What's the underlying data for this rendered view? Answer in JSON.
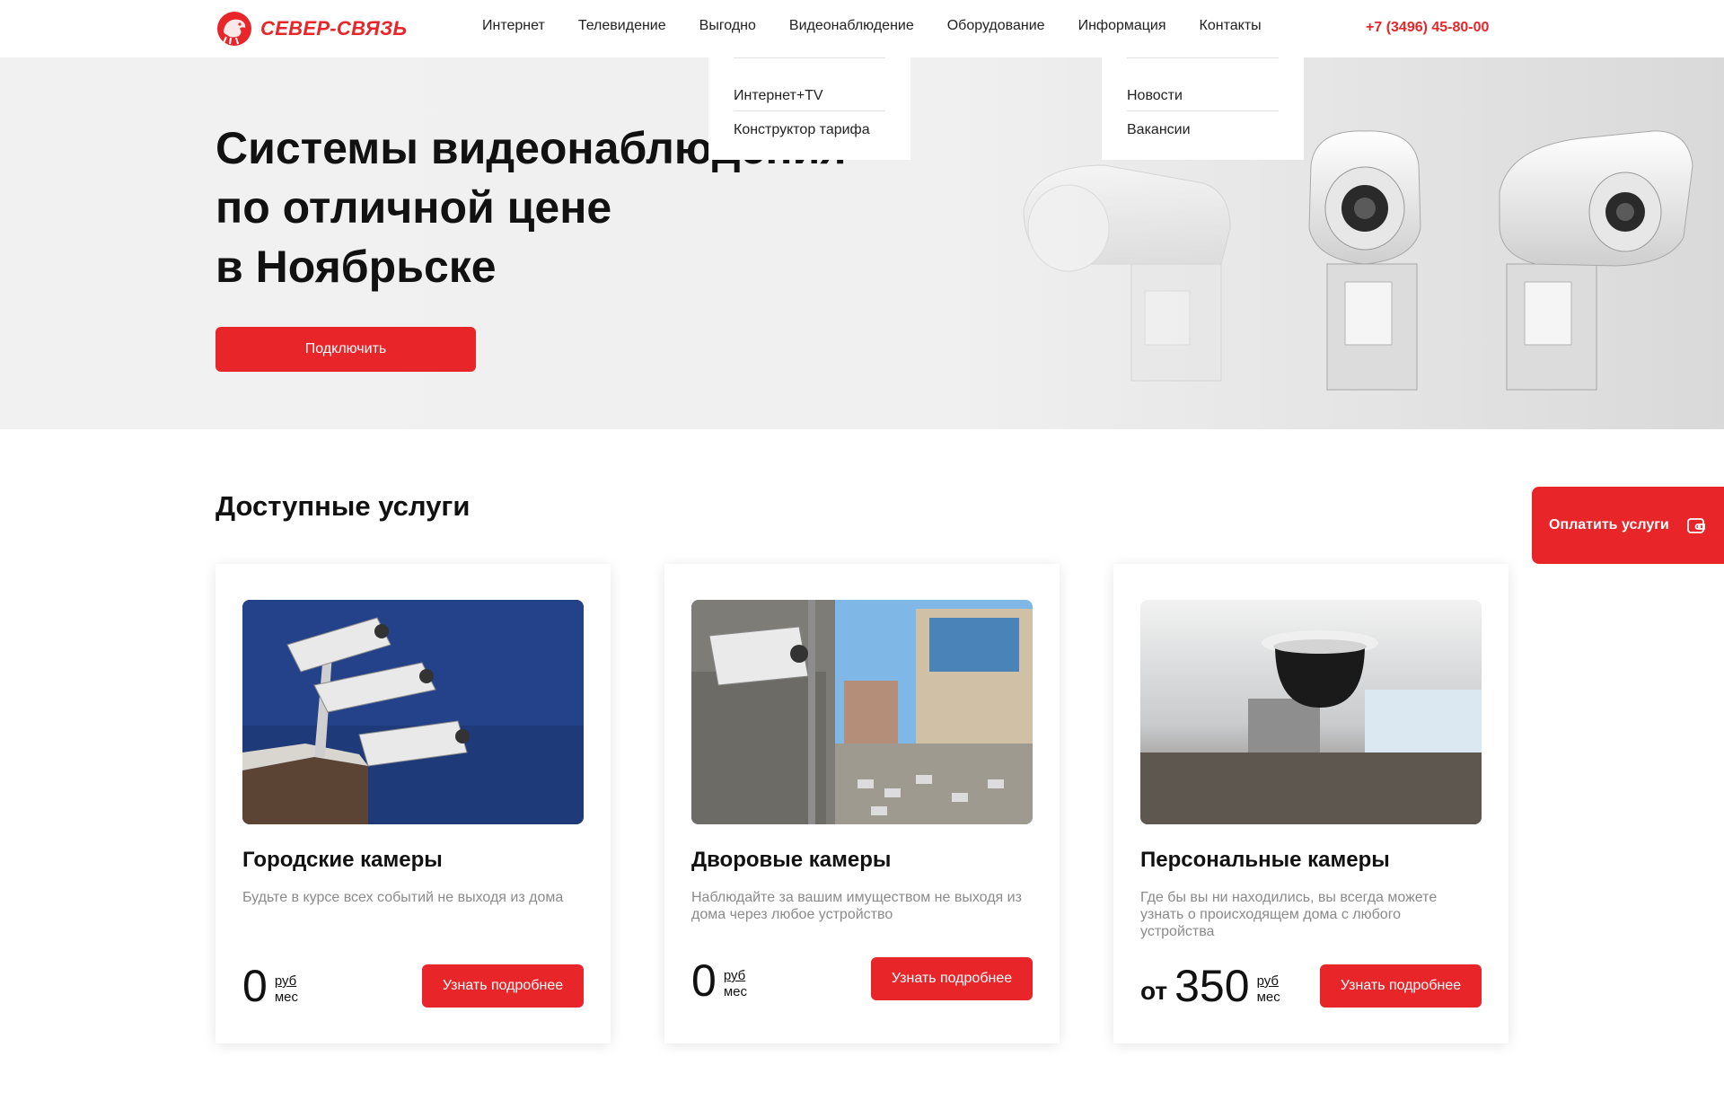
{
  "header": {
    "logo_text": "СЕВЕР-СВЯЗЬ",
    "nav": [
      {
        "label": "Интернет"
      },
      {
        "label": "Телевидение"
      },
      {
        "label": "Выгодно"
      },
      {
        "label": "Видеонаблюдение"
      },
      {
        "label": "Оборудование"
      },
      {
        "label": "Информация"
      },
      {
        "label": "Контакты"
      }
    ],
    "phone": "+7 (3496) 45-80-00"
  },
  "dropdowns": {
    "vygodno": [
      "Интернет+TV",
      "Конструктор тарифа"
    ],
    "informaciya": [
      "Новости",
      "Вакансии"
    ]
  },
  "hero": {
    "title_lines": [
      "Системы видеонаблюдения",
      "по отличной цене",
      "в Ноябрьске"
    ],
    "button": "Подключить"
  },
  "services": {
    "title": "Доступные услуги",
    "pay_button": "Оплатить услуги",
    "cards": [
      {
        "title": "Городские камеры",
        "description": "Будьте в курсе всех событий не выходя из дома",
        "price_prefix": "",
        "price": "0",
        "unit_top": "руб",
        "unit_bottom": "мес",
        "button": "Узнать подробнее"
      },
      {
        "title": "Дворовые камеры",
        "description": "Наблюдайте за вашим имуществом не выходя из дома через любое устройство",
        "price_prefix": "",
        "price": "0",
        "unit_top": "руб",
        "unit_bottom": "мес",
        "button": "Узнать подробнее"
      },
      {
        "title": "Персональные камеры",
        "description": "Где бы вы ни находились, вы всегда можете узнать о происходящем дома с любого устройства",
        "price_prefix": "от",
        "price": "350",
        "unit_top": "руб",
        "unit_bottom": "мес",
        "button": "Узнать подробнее"
      }
    ]
  },
  "colors": {
    "accent": "#e8262a",
    "text": "#111111",
    "muted": "#8a8a8a"
  }
}
